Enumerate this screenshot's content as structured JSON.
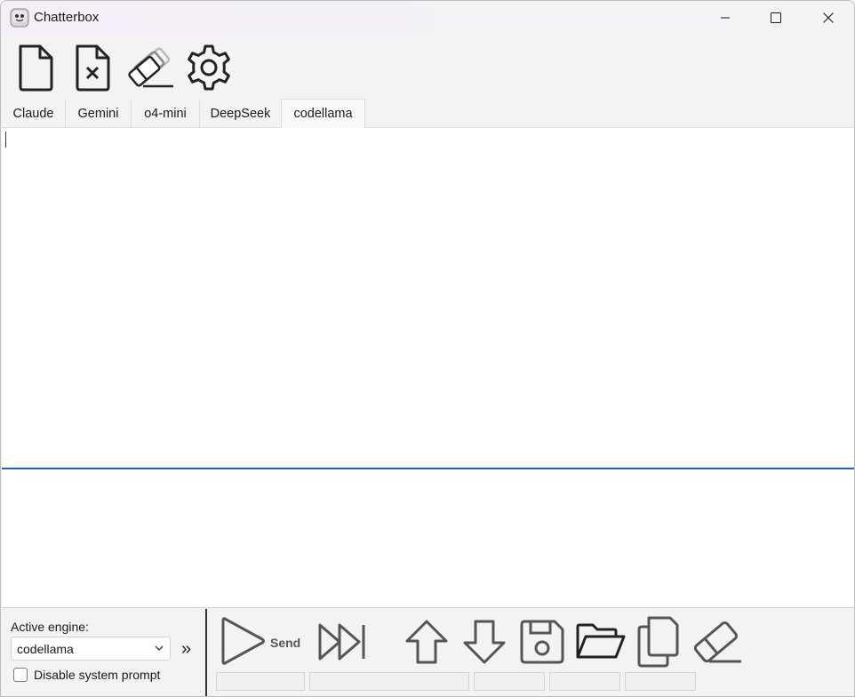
{
  "window": {
    "title": "Chatterbox"
  },
  "toolbar": {
    "buttons": [
      {
        "icon": "new-file-icon"
      },
      {
        "icon": "close-file-icon"
      },
      {
        "icon": "clear-all-icon"
      },
      {
        "icon": "settings-gear-icon"
      }
    ]
  },
  "tabs": [
    {
      "label": "Claude",
      "active": false
    },
    {
      "label": "Gemini",
      "active": false
    },
    {
      "label": "o4-mini",
      "active": false
    },
    {
      "label": "DeepSeek",
      "active": false
    },
    {
      "label": "codellama",
      "active": true
    }
  ],
  "main": {
    "output_text": "",
    "input_text": ""
  },
  "bottom": {
    "engine_label": "Active engine:",
    "engine_value": "codellama",
    "expand_glyph": "»",
    "disable_system_prompt_label": "Disable system prompt",
    "disable_system_prompt_checked": false,
    "send_label": "Send",
    "actions": [
      "send-icon",
      "fast-forward-icon",
      "arrow-up-icon",
      "arrow-down-icon",
      "save-icon",
      "open-folder-icon",
      "copy-icon",
      "eraser-icon"
    ]
  },
  "colors": {
    "accent": "#1b63b6",
    "background": "#f3f3f3",
    "icon_dark": "#222222",
    "icon_gray": "#555555"
  }
}
